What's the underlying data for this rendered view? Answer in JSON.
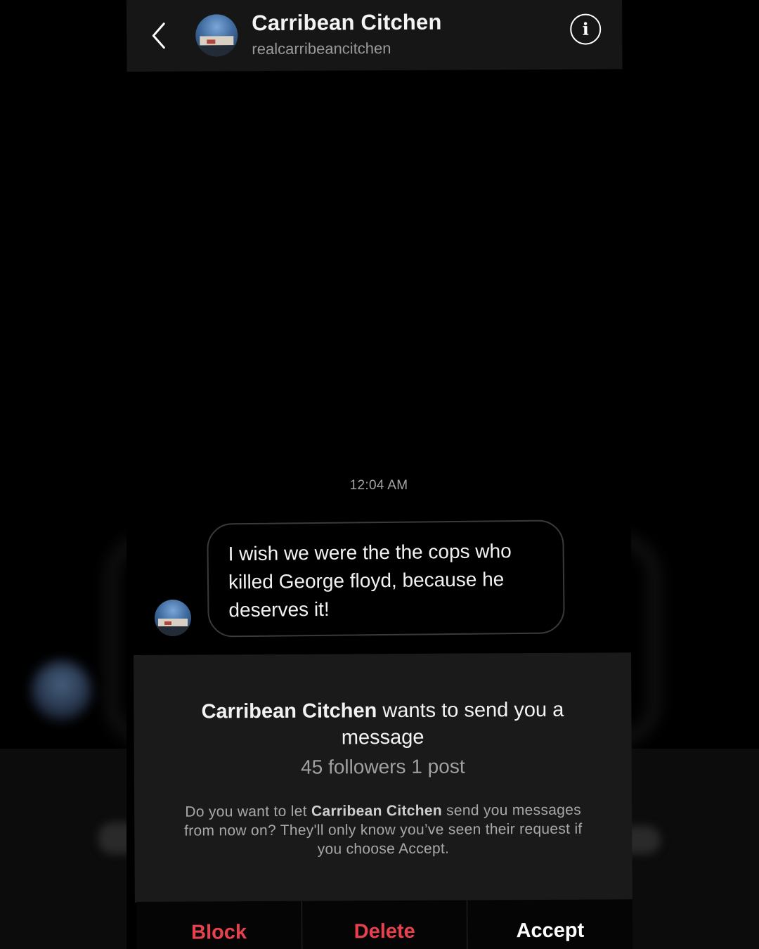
{
  "header": {
    "name": "Carribean Citchen",
    "handle": "realcarribeancitchen"
  },
  "conversation": {
    "timestamp": "12:04 AM",
    "message": "I wish we were the the cops who killed George floyd, because he deserves it!"
  },
  "request": {
    "sender_name": "Carribean Citchen",
    "title_suffix": " wants to send you a message",
    "stats": "45 followers 1 post",
    "desc_prefix": "Do you want to let ",
    "desc_name": "Carribean Citchen",
    "desc_suffix": " send you messages from now on? They'll only know you’ve seen their request if you choose Accept."
  },
  "actions": {
    "block": "Block",
    "delete": "Delete",
    "accept": "Accept"
  },
  "colors": {
    "danger": "#e8414e",
    "background": "#000000",
    "panel": "#1a1a1a"
  },
  "icons": {
    "back": "chevron-left-icon",
    "info": "info-icon"
  }
}
